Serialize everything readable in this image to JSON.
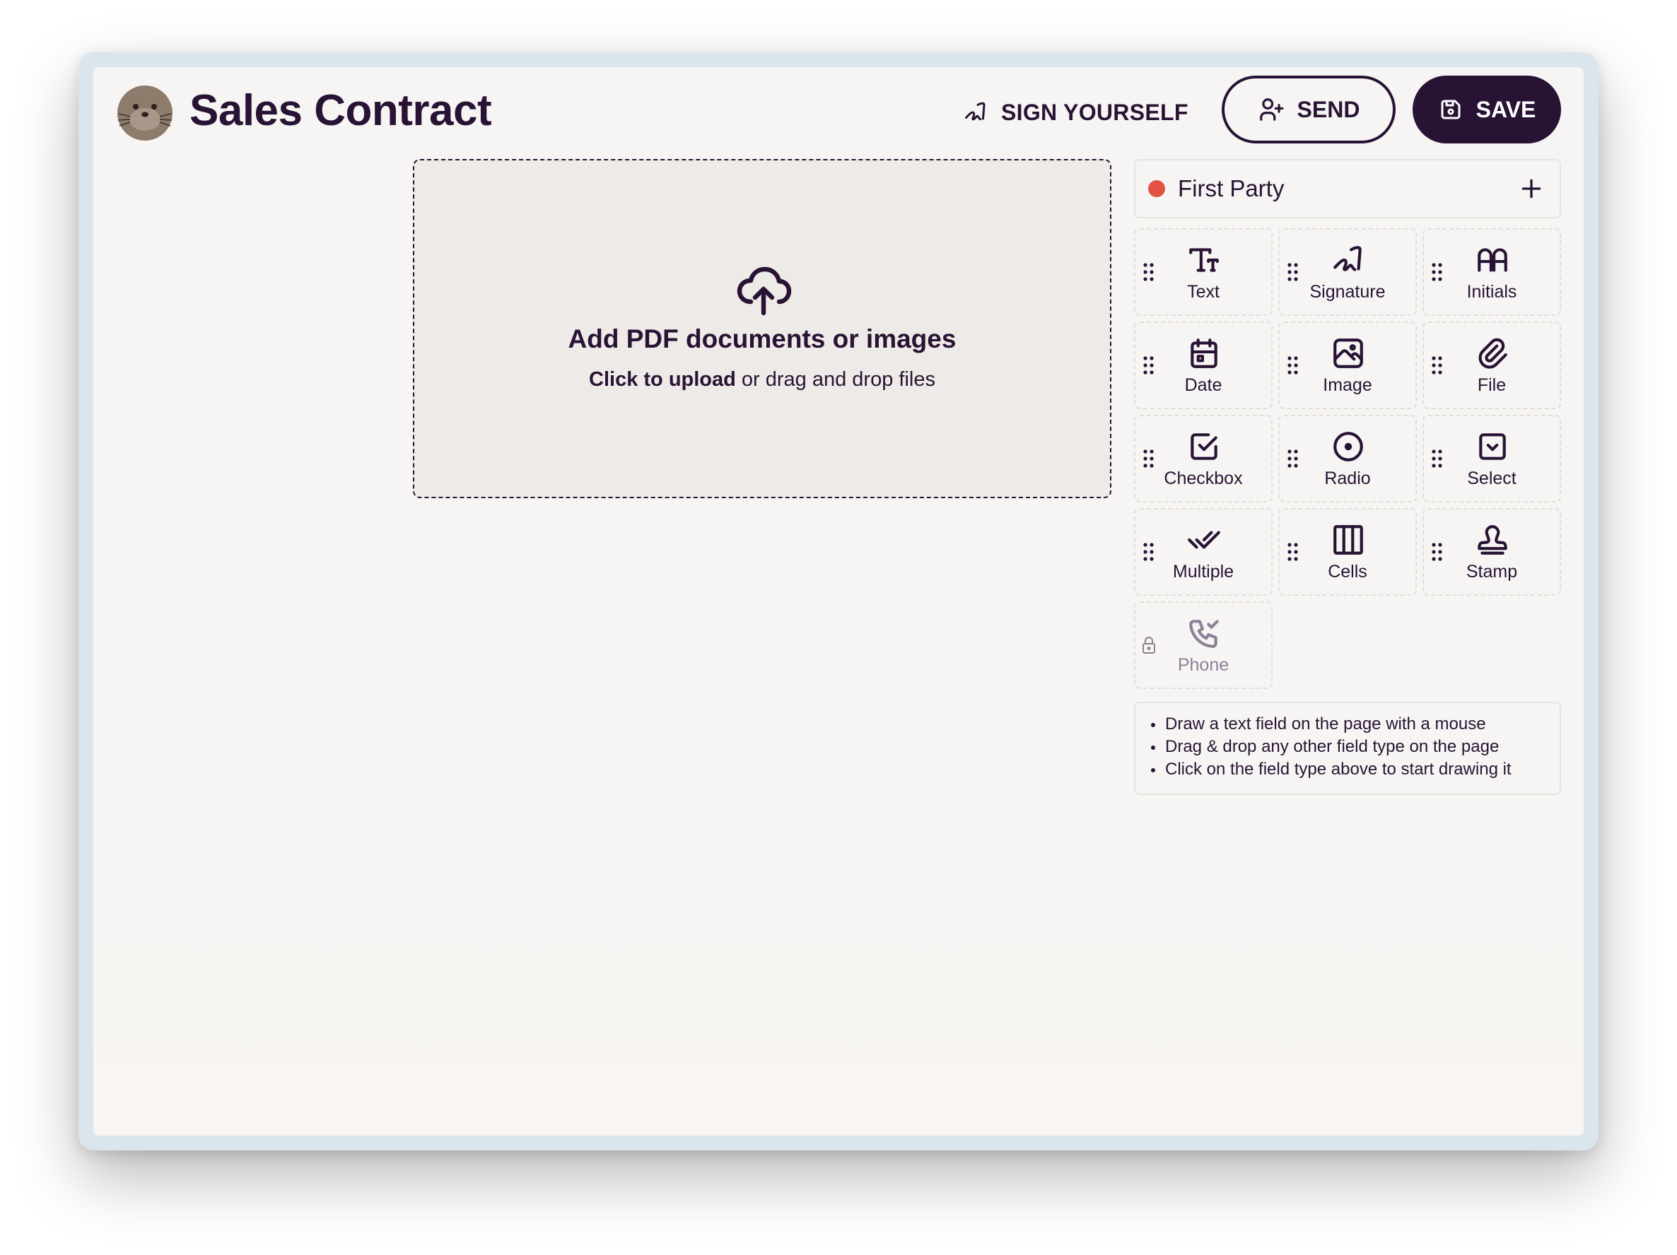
{
  "header": {
    "title": "Sales Contract",
    "sign_yourself_label": "SIGN YOURSELF",
    "send_label": "SEND",
    "save_label": "SAVE"
  },
  "upload": {
    "title": "Add PDF documents or images",
    "sub_strong": "Click to upload",
    "sub_rest": " or drag and drop files"
  },
  "party": {
    "name": "First Party",
    "color": "#e25344"
  },
  "fields": [
    {
      "label": "Text",
      "icon": "text-size-icon"
    },
    {
      "label": "Signature",
      "icon": "signature-icon"
    },
    {
      "label": "Initials",
      "icon": "initials-icon"
    },
    {
      "label": "Date",
      "icon": "calendar-icon"
    },
    {
      "label": "Image",
      "icon": "image-icon"
    },
    {
      "label": "File",
      "icon": "paperclip-icon"
    },
    {
      "label": "Checkbox",
      "icon": "checkbox-icon"
    },
    {
      "label": "Radio",
      "icon": "radio-icon"
    },
    {
      "label": "Select",
      "icon": "select-icon"
    },
    {
      "label": "Multiple",
      "icon": "double-check-icon"
    },
    {
      "label": "Cells",
      "icon": "columns-icon"
    },
    {
      "label": "Stamp",
      "icon": "stamp-icon"
    },
    {
      "label": "Phone",
      "icon": "phone-check-icon",
      "locked": true
    }
  ],
  "hints": [
    "Draw a text field on the page with a mouse",
    "Drag & drop any other field type on the page",
    "Click on the field type above to start drawing it"
  ],
  "colors": {
    "primary": "#291334",
    "background": "#f6f5f3",
    "upload_bg": "#eeeae7",
    "party_dot": "#e25344"
  }
}
